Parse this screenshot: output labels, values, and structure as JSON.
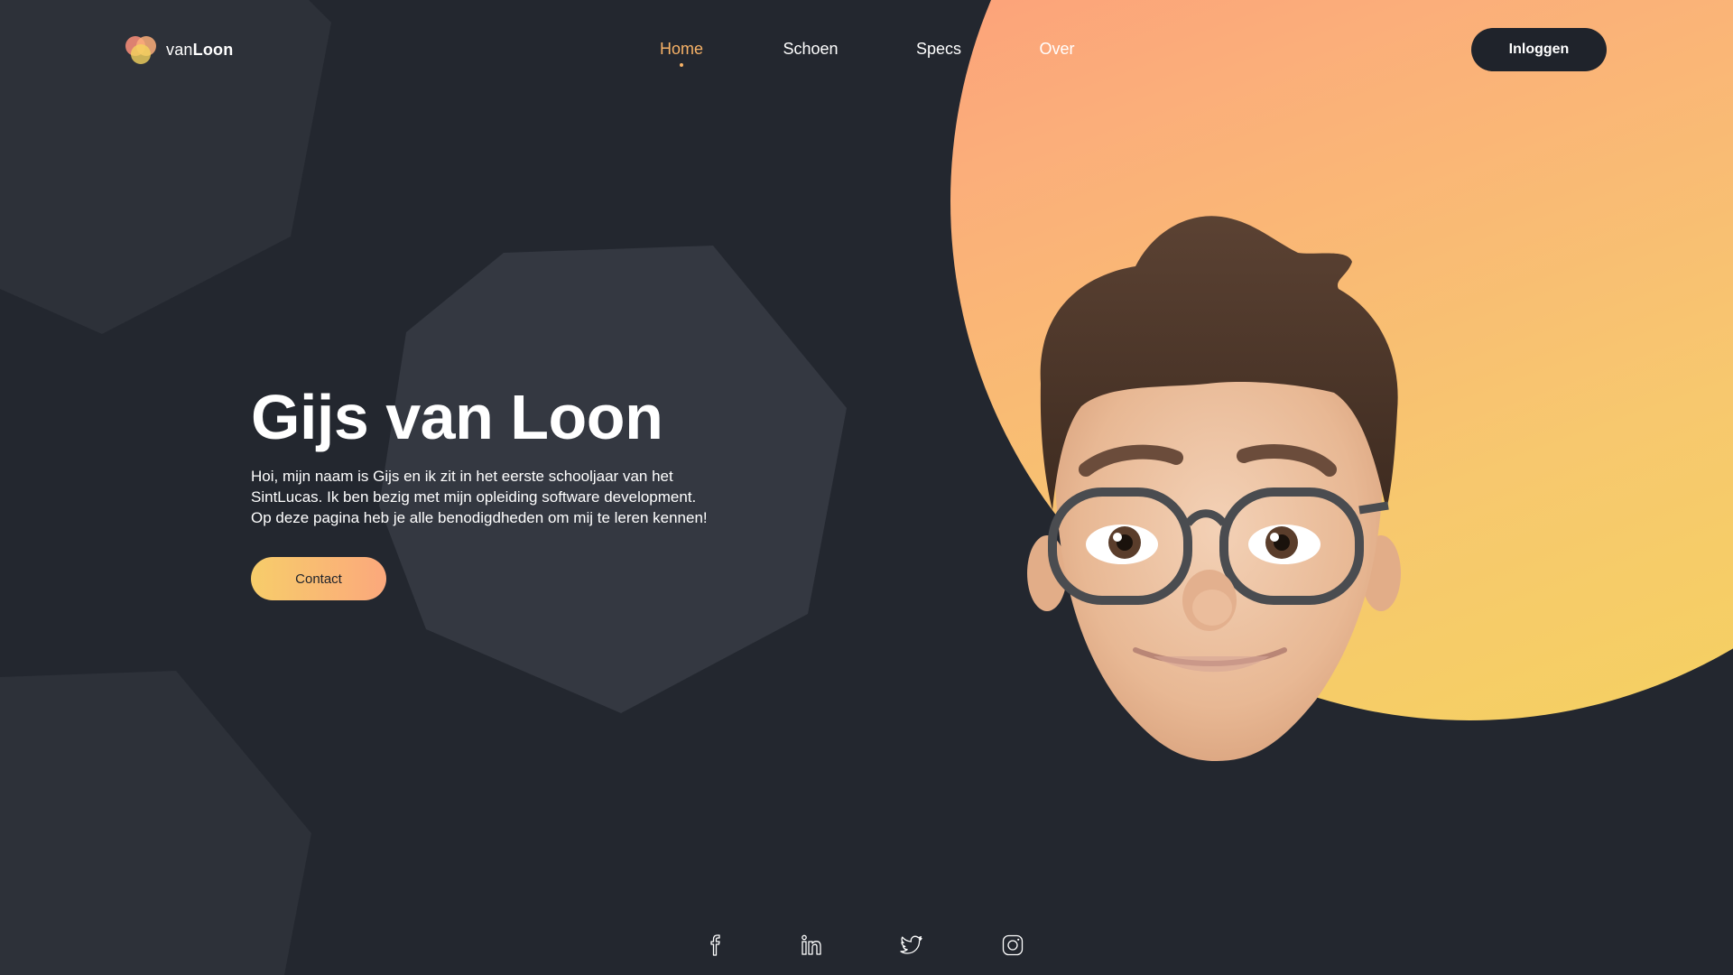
{
  "brand": {
    "prefix": "van",
    "name": "Loon"
  },
  "nav": {
    "items": [
      {
        "label": "Home",
        "active": true
      },
      {
        "label": "Schoen",
        "active": false
      },
      {
        "label": "Specs",
        "active": false
      },
      {
        "label": "Over",
        "active": false
      }
    ],
    "login_label": "Inloggen"
  },
  "hero": {
    "title": "Gijs van Loon",
    "lines": [
      "Hoi, mijn naam is Gijs en ik zit in het eerste schooljaar van het",
      "SintLucas. Ik ben bezig met mijn opleiding software development.",
      "Op deze pagina heb je alle benodigdheden om mij te leren kennen!"
    ],
    "contact_label": "Contact"
  },
  "social": [
    {
      "icon": "facebook-icon"
    },
    {
      "icon": "linkedin-icon"
    },
    {
      "icon": "twitter-icon"
    },
    {
      "icon": "instagram-icon"
    }
  ],
  "colors": {
    "background": "#23272f",
    "shape": "#2d3139",
    "accent": "#f7b267",
    "gradient_start": "#fd8f7a",
    "gradient_end": "#f4d35e",
    "button_dark": "#1f232b"
  }
}
